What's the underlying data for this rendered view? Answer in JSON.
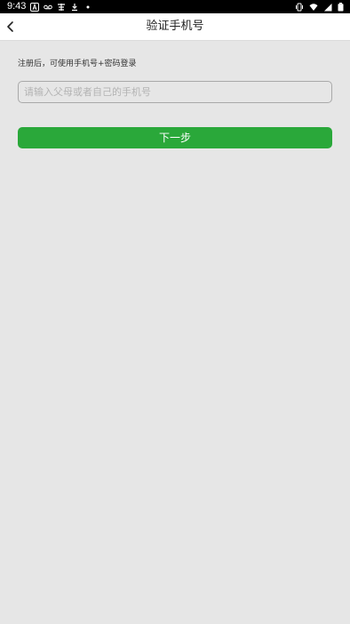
{
  "status_bar": {
    "time": "9:43",
    "left_icons": [
      "text-a-icon",
      "voicemail-icon",
      "game-icon",
      "download-icon",
      "dot-icon"
    ],
    "right_icons": [
      "vibrate-icon",
      "wifi-icon",
      "signal-icon",
      "battery-icon"
    ]
  },
  "header": {
    "title": "验证手机号",
    "back_icon": "chevron-left-icon"
  },
  "form": {
    "hint": "注册后，可使用手机号+密码登录",
    "phone_input": {
      "value": "",
      "placeholder": "请输入父母或者自己的手机号"
    },
    "next_button_label": "下一步"
  },
  "colors": {
    "background": "#e6e6e6",
    "header_background": "#ffffff",
    "status_bar_background": "#000000",
    "primary_button": "#2aa83a"
  }
}
